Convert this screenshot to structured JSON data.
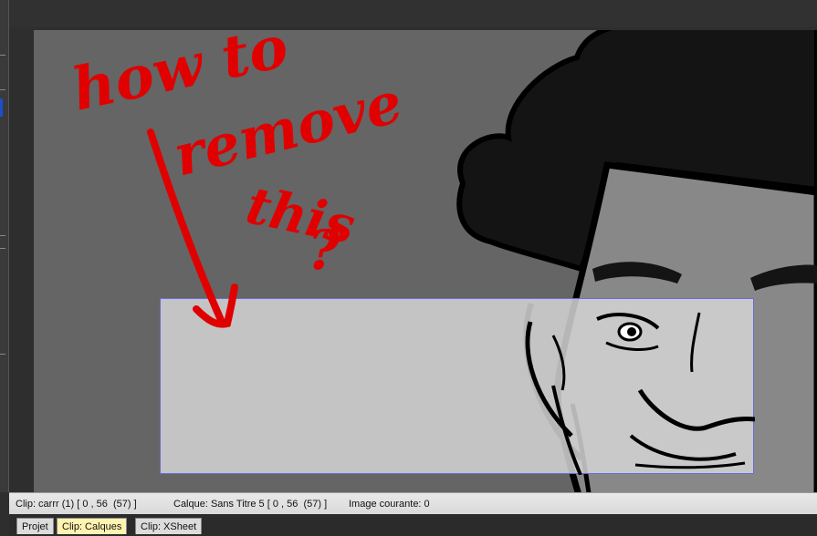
{
  "status": {
    "clip_info": "Clip: carrr (1) [ 0 , 56  (57) ]",
    "layer_info": "Calque: Sans Titre 5 [ 0 , 56  (57) ]",
    "current_image": "Image courante: 0"
  },
  "tabs": [
    {
      "label": "Projet",
      "active": false
    },
    {
      "label": "Clip: Calques",
      "active": true
    },
    {
      "label": "Clip: XSheet",
      "active": false
    }
  ],
  "canvas": {
    "annotation_lines": [
      "how to",
      "remove",
      "this",
      "?"
    ],
    "annotation_color": "#e00000"
  }
}
